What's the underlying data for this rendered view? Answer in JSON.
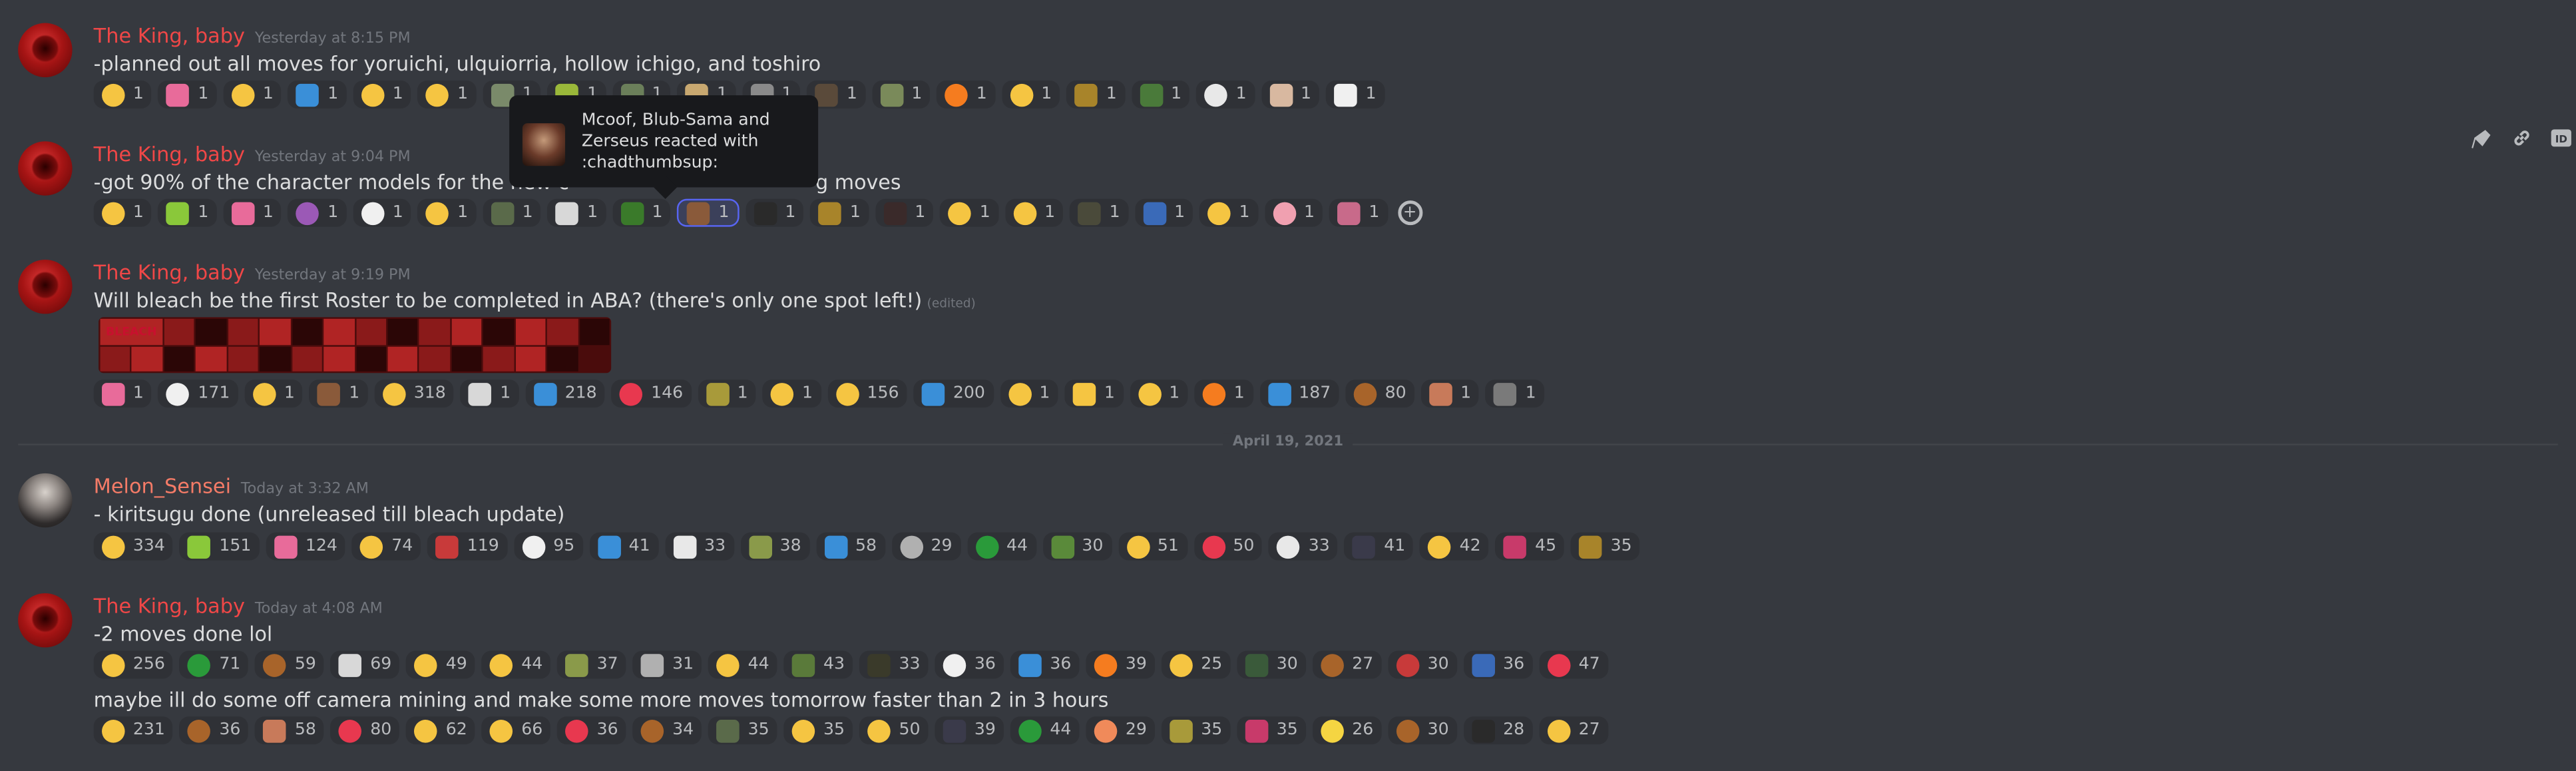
{
  "messages": [
    {
      "author": "The King, baby",
      "time": "Yesterday at 8:15 PM",
      "text": "-planned out all moves for yoruichi, ulquiorria, hollow ichigo, and toshiro",
      "reactions": [
        {
          "icon": "sunglasses-emoji",
          "color": "#f5c542",
          "count": "1"
        },
        {
          "icon": "custom-emoji",
          "color": "#e86b9a",
          "count": "1"
        },
        {
          "icon": "tongue-emoji",
          "color": "#f5c542",
          "count": "1"
        },
        {
          "icon": "ok-emoji",
          "color": "#3a8fd8",
          "count": "1"
        },
        {
          "icon": "smirk-emoji",
          "color": "#f5c542",
          "count": "1"
        },
        {
          "icon": "joy-emoji",
          "color": "#f5c542",
          "count": "1"
        },
        {
          "icon": "custom-emoji",
          "color": "#7a8a6a",
          "count": "1"
        },
        {
          "icon": "custom-emoji",
          "color": "#9ab83a",
          "count": "1"
        },
        {
          "icon": "custom-emoji",
          "color": "#6b7f5a",
          "count": "1"
        },
        {
          "icon": "custom-emoji",
          "color": "#c8a870",
          "count": "1"
        },
        {
          "icon": "custom-emoji",
          "color": "#8a8a8a",
          "count": "1"
        },
        {
          "icon": "custom-emoji",
          "color": "#5a4a3a",
          "count": "1"
        },
        {
          "icon": "custom-emoji",
          "color": "#7a8a5a",
          "count": "1"
        },
        {
          "icon": "fire-emoji",
          "color": "#f57c1f",
          "count": "1"
        },
        {
          "icon": "scream-emoji",
          "color": "#f5c542",
          "count": "1"
        },
        {
          "icon": "custom-emoji",
          "color": "#a8842a",
          "count": "1"
        },
        {
          "icon": "custom-emoji",
          "color": "#4a7a3a",
          "count": "1"
        },
        {
          "icon": "skull-emoji",
          "color": "#e8e8e8",
          "count": "1"
        },
        {
          "icon": "custom-emoji",
          "color": "#d8b8a0",
          "count": "1"
        },
        {
          "icon": "custom-emoji",
          "color": "#f0f0f0",
          "count": "1"
        }
      ]
    },
    {
      "author": "The King, baby",
      "time": "Yesterday at 9:04 PM",
      "text_left": "-got 90% of the character models for the new c",
      "text_right": "g moves",
      "reactions": [
        {
          "icon": "point-up-emoji",
          "color": "#f5c542",
          "count": "1"
        },
        {
          "icon": "custom-emoji",
          "color": "#8ac83a",
          "count": "1"
        },
        {
          "icon": "custom-emoji",
          "color": "#e86b9a",
          "count": "1"
        },
        {
          "icon": "imp-emoji",
          "color": "#9b59b6",
          "count": "1"
        },
        {
          "icon": "clown-emoji",
          "color": "#f0f0f0",
          "count": "1"
        },
        {
          "icon": "unamused-emoji",
          "color": "#f5c542",
          "count": "1"
        },
        {
          "icon": "custom-emoji",
          "color": "#5a6a4a",
          "count": "1"
        },
        {
          "icon": "custom-emoji",
          "color": "#d8d8d8",
          "count": "1"
        },
        {
          "icon": "custom-emoji",
          "color": "#3a7a2a",
          "count": "1"
        },
        {
          "icon": "custom-emoji",
          "color": "#8a5a3a",
          "count": "1",
          "me": true
        },
        {
          "icon": "custom-emoji",
          "color": "#2a2a2a",
          "count": "1"
        },
        {
          "icon": "custom-emoji",
          "color": "#a8842a",
          "count": "1"
        },
        {
          "icon": "custom-emoji",
          "color": "#3a2a2a",
          "count": "1"
        },
        {
          "icon": "heart-eyes-emoji",
          "color": "#f5c542",
          "count": "1"
        },
        {
          "icon": "clap-emoji",
          "color": "#f5c542",
          "count": "1"
        },
        {
          "icon": "custom-emoji",
          "color": "#4a4a3a",
          "count": "1"
        },
        {
          "icon": "custom-emoji",
          "color": "#3a6ab8",
          "count": "1"
        },
        {
          "icon": "smile-emoji",
          "color": "#f5c542",
          "count": "1"
        },
        {
          "icon": "brain-emoji",
          "color": "#f0a0b0",
          "count": "1"
        },
        {
          "icon": "custom-emoji",
          "color": "#c86a8a",
          "count": "1"
        }
      ]
    },
    {
      "author": "The King, baby",
      "time": "Yesterday at 9:19 PM",
      "text": "Will bleach be the first Roster to be completed in ABA? (there's only one spot left!)",
      "edited": "(edited)",
      "attachment_logo": "BLEACH",
      "reactions": [
        {
          "icon": "custom-emoji",
          "color": "#e86b9a",
          "count": "1"
        },
        {
          "icon": "clown-emoji",
          "color": "#f0f0f0",
          "count": "171"
        },
        {
          "icon": "relieved-emoji",
          "color": "#f5c542",
          "count": "1"
        },
        {
          "icon": "custom-emoji",
          "color": "#8a5a3a",
          "count": "1"
        },
        {
          "icon": "thumbsup-emoji",
          "color": "#f5c542",
          "count": "318"
        },
        {
          "icon": "custom-emoji",
          "color": "#d8d8d8",
          "count": "1"
        },
        {
          "icon": "regional-y-emoji",
          "color": "#3a8fd8",
          "count": "218"
        },
        {
          "icon": "heart-emoji",
          "color": "#e8384f",
          "count": "146"
        },
        {
          "icon": "custom-emoji",
          "color": "#a89a3a",
          "count": "1"
        },
        {
          "icon": "raised-eyebrow-emoji",
          "color": "#f5c542",
          "count": "1"
        },
        {
          "icon": "scream-emoji",
          "color": "#f5c542",
          "count": "156"
        },
        {
          "icon": "regional-e-emoji",
          "color": "#3a8fd8",
          "count": "200"
        },
        {
          "icon": "joy-emoji",
          "color": "#f5c542",
          "count": "1"
        },
        {
          "icon": "custom-emoji",
          "color": "#f5c542",
          "count": "1"
        },
        {
          "icon": "thinking-emoji",
          "color": "#f5c542",
          "count": "1"
        },
        {
          "icon": "hot-face-emoji",
          "color": "#f57c1f",
          "count": "1"
        },
        {
          "icon": "regional-s-emoji",
          "color": "#3a8fd8",
          "count": "187"
        },
        {
          "icon": "squirrel-emoji",
          "color": "#a8642a",
          "count": "80"
        },
        {
          "icon": "custom-emoji",
          "color": "#c87a5a",
          "count": "1"
        },
        {
          "icon": "custom-emoji",
          "color": "#7a7a7a",
          "count": "1"
        }
      ]
    },
    {
      "author": "Melon_Sensei",
      "time": "Today at 3:32 AM",
      "text": "- kiritsugu done (unreleased till bleach update)",
      "reactions": [
        {
          "icon": "tired-face-emoji",
          "color": "#f5c542",
          "count": "334"
        },
        {
          "icon": "custom-emoji",
          "color": "#8ac83a",
          "count": "151"
        },
        {
          "icon": "custom-emoji",
          "color": "#e86b9a",
          "count": "124"
        },
        {
          "icon": "scream-emoji",
          "color": "#f5c542",
          "count": "74"
        },
        {
          "icon": "custom-emoji",
          "color": "#c83a3a",
          "count": "119"
        },
        {
          "icon": "clown-emoji",
          "color": "#f0f0f0",
          "count": "95"
        },
        {
          "icon": "custom-emoji",
          "color": "#3a8fd8",
          "count": "41"
        },
        {
          "icon": "custom-emoji",
          "color": "#e8e8e8",
          "count": "33"
        },
        {
          "icon": "custom-emoji",
          "color": "#8a9a4a",
          "count": "38"
        },
        {
          "icon": "ok-emoji",
          "color": "#3a8fd8",
          "count": "58"
        },
        {
          "icon": "fork-knife-emoji",
          "color": "#b0b0b0",
          "count": "29"
        },
        {
          "icon": "brazil-flag-emoji",
          "color": "#2a9a3a",
          "count": "44"
        },
        {
          "icon": "custom-emoji",
          "color": "#5a8a3a",
          "count": "30"
        },
        {
          "icon": "sob-emoji",
          "color": "#f5c542",
          "count": "51"
        },
        {
          "icon": "heart-emoji",
          "color": "#e8384f",
          "count": "50"
        },
        {
          "icon": "skull-emoji",
          "color": "#e8e8e8",
          "count": "33"
        },
        {
          "icon": "custom-emoji",
          "color": "#3a3a4a",
          "count": "41"
        },
        {
          "icon": "sunglasses-emoji",
          "color": "#f5c542",
          "count": "42"
        },
        {
          "icon": "custom-emoji",
          "color": "#c83a6a",
          "count": "45"
        },
        {
          "icon": "custom-emoji",
          "color": "#a8842a",
          "count": "35"
        }
      ]
    },
    {
      "author": "The King, baby",
      "time": "Today at 4:08 AM",
      "text": "-2 moves done lol",
      "reactions": [
        {
          "icon": "thumbsup-emoji",
          "color": "#f5c542",
          "count": "256"
        },
        {
          "icon": "brazil-flag-emoji",
          "color": "#2a9a3a",
          "count": "71"
        },
        {
          "icon": "ok-hand-emoji",
          "color": "#a8642a",
          "count": "59"
        },
        {
          "icon": "custom-emoji",
          "color": "#d8d8d8",
          "count": "69"
        },
        {
          "icon": "pray-emoji",
          "color": "#f5c542",
          "count": "49"
        },
        {
          "icon": "grimace-emoji",
          "color": "#f5c542",
          "count": "44"
        },
        {
          "icon": "custom-emoji",
          "color": "#8a9a4a",
          "count": "37"
        },
        {
          "icon": "custom-emoji",
          "color": "#b0b0b0",
          "count": "31"
        },
        {
          "icon": "relieved-emoji",
          "color": "#f5c542",
          "count": "44"
        },
        {
          "icon": "custom-emoji",
          "color": "#5a7a3a",
          "count": "43"
        },
        {
          "icon": "custom-emoji",
          "color": "#3a3a2a",
          "count": "33"
        },
        {
          "icon": "clown-emoji",
          "color": "#f0f0f0",
          "count": "36"
        },
        {
          "icon": "ok-emoji",
          "color": "#3a8fd8",
          "count": "36"
        },
        {
          "icon": "fire-emoji",
          "color": "#f57c1f",
          "count": "39"
        },
        {
          "icon": "raised-eyebrow-emoji",
          "color": "#f5c542",
          "count": "25"
        },
        {
          "icon": "custom-emoji",
          "color": "#3a5a3a",
          "count": "30"
        },
        {
          "icon": "monkey-emoji",
          "color": "#a8642a",
          "count": "27"
        },
        {
          "icon": "anger-emoji",
          "color": "#c83a3a",
          "count": "30"
        },
        {
          "icon": "custom-emoji",
          "color": "#3a6ab8",
          "count": "36"
        },
        {
          "icon": "hot-face-emoji",
          "color": "#e8384f",
          "count": "47"
        }
      ],
      "text2": "maybe ill do some off camera mining and make some more moves tomorrow faster than 2 in 3 hours",
      "reactions2": [
        {
          "icon": "smirk-emoji",
          "color": "#f5c542",
          "count": "231"
        },
        {
          "icon": "poop-emoji",
          "color": "#a8642a",
          "count": "36"
        },
        {
          "icon": "custom-emoji",
          "color": "#c87a5a",
          "count": "58"
        },
        {
          "icon": "heart-emoji",
          "color": "#e8384f",
          "count": "80"
        },
        {
          "icon": "sunglasses-emoji",
          "color": "#f5c542",
          "count": "62"
        },
        {
          "icon": "flushed-emoji",
          "color": "#f5c542",
          "count": "66"
        },
        {
          "icon": "watermelon-emoji",
          "color": "#e8384f",
          "count": "36"
        },
        {
          "icon": "squirrel-emoji",
          "color": "#a8642a",
          "count": "34"
        },
        {
          "icon": "custom-emoji",
          "color": "#5a6a4a",
          "count": "35"
        },
        {
          "icon": "point-up-emoji",
          "color": "#f5c542",
          "count": "35"
        },
        {
          "icon": "relieved-emoji",
          "color": "#f5c542",
          "count": "50"
        },
        {
          "icon": "custom-emoji",
          "color": "#3a3a4a",
          "count": "39"
        },
        {
          "icon": "brazil-flag-emoji",
          "color": "#2a9a3a",
          "count": "44"
        },
        {
          "icon": "peach-emoji",
          "color": "#f08a5a",
          "count": "29"
        },
        {
          "icon": "custom-emoji",
          "color": "#a89a3a",
          "count": "35"
        },
        {
          "icon": "custom-emoji",
          "color": "#c83a6a",
          "count": "35"
        },
        {
          "icon": "chick-emoji",
          "color": "#f5d542",
          "count": "26"
        },
        {
          "icon": "monkey-emoji",
          "color": "#a8642a",
          "count": "30"
        },
        {
          "icon": "custom-emoji",
          "color": "#2a2a2a",
          "count": "28"
        },
        {
          "icon": "monocle-emoji",
          "color": "#f5c542",
          "count": "27"
        }
      ]
    }
  ],
  "divider_label": "April 19, 2021",
  "tooltip": {
    "text": "Mcoof, Blub-Sama and Zerseus reacted with :chadthumbsup:"
  },
  "toolbar": [
    "pin-icon",
    "link-icon",
    "id-icon"
  ]
}
